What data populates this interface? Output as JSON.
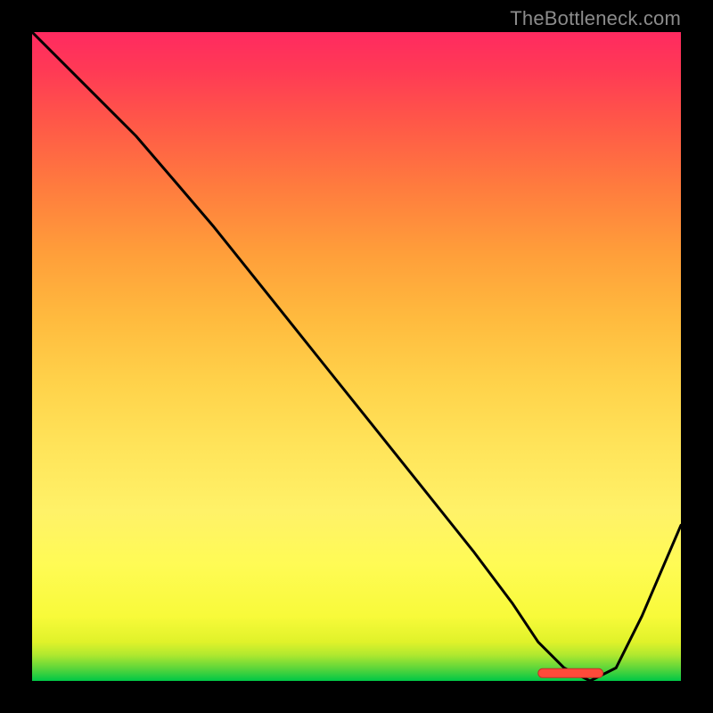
{
  "watermark": "TheBottleneck.com",
  "colors": {
    "background": "#000000",
    "curve": "#000000",
    "marker_fill": "#ff4a3a",
    "marker_stroke": "#c33228",
    "watermark": "#8b8b8b"
  },
  "chart_data": {
    "type": "line",
    "title": "",
    "xlabel": "",
    "ylabel": "",
    "xlim": [
      0,
      100
    ],
    "ylim": [
      0,
      100
    ],
    "grid": false,
    "legend": false,
    "x": [
      0,
      8,
      16,
      22,
      28,
      36,
      44,
      52,
      60,
      68,
      74,
      78,
      82,
      86,
      90,
      94,
      100
    ],
    "values": [
      100,
      92,
      84,
      77,
      70,
      60,
      50,
      40,
      30,
      20,
      12,
      6,
      2,
      0,
      2,
      10,
      24
    ],
    "annotations": [
      {
        "type": "marker",
        "shape": "pill",
        "x_start": 78,
        "x_end": 88,
        "y": 1.2
      }
    ]
  }
}
